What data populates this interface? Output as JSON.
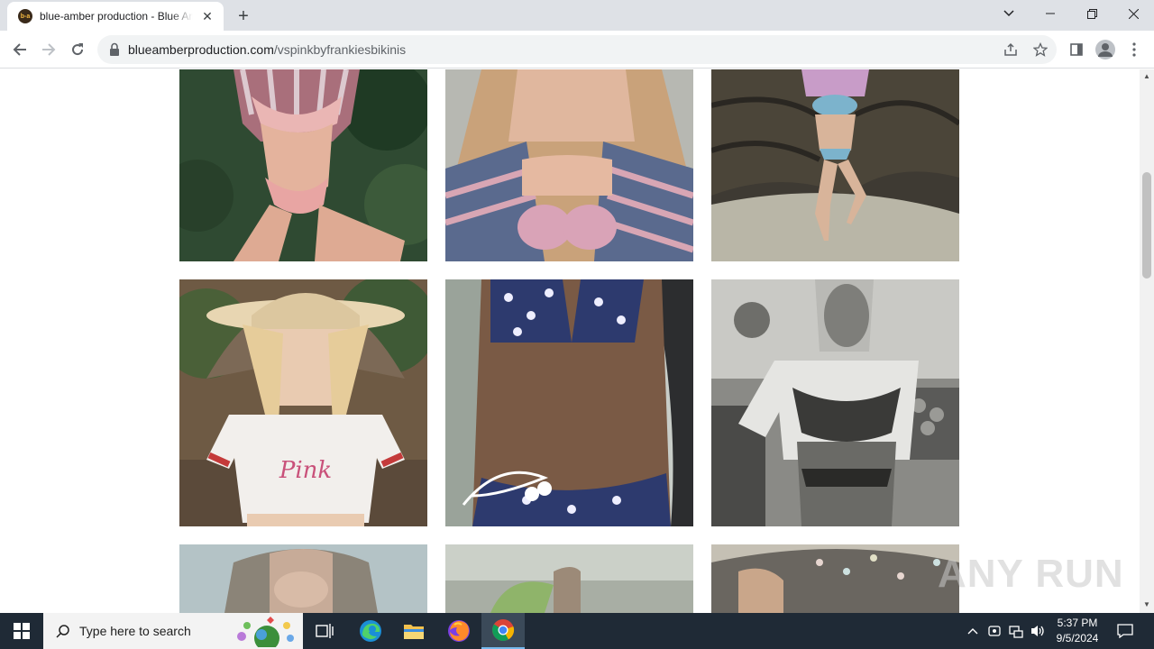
{
  "browser": {
    "tab_title": "blue-amber production - Blue Amber",
    "favicon_text": "b-a",
    "url_host": "blueamberproduction.com",
    "url_path": "/vspinkbyfrankiesbikinis"
  },
  "gallery": {
    "photos": [
      {
        "id": "photo-1",
        "alt": "model in pink bikini, striped top"
      },
      {
        "id": "photo-2",
        "alt": "pink bikini top, striped towel"
      },
      {
        "id": "photo-3",
        "alt": "model posing on tree trunk"
      },
      {
        "id": "photo-4",
        "alt": "model in cowboy hat and Pink tee"
      },
      {
        "id": "photo-5",
        "alt": "navy floral bikini"
      },
      {
        "id": "photo-6",
        "alt": "model in jersey at fruit stand"
      },
      {
        "id": "photo-7",
        "alt": "model portrait"
      },
      {
        "id": "photo-8",
        "alt": "model on beach"
      },
      {
        "id": "photo-9",
        "alt": "model by rock"
      }
    ],
    "pink_shirt_text": "Pink"
  },
  "watermark": "ANY RUN",
  "taskbar": {
    "search_placeholder": "Type here to search",
    "time": "5:37 PM",
    "date": "9/5/2024"
  }
}
